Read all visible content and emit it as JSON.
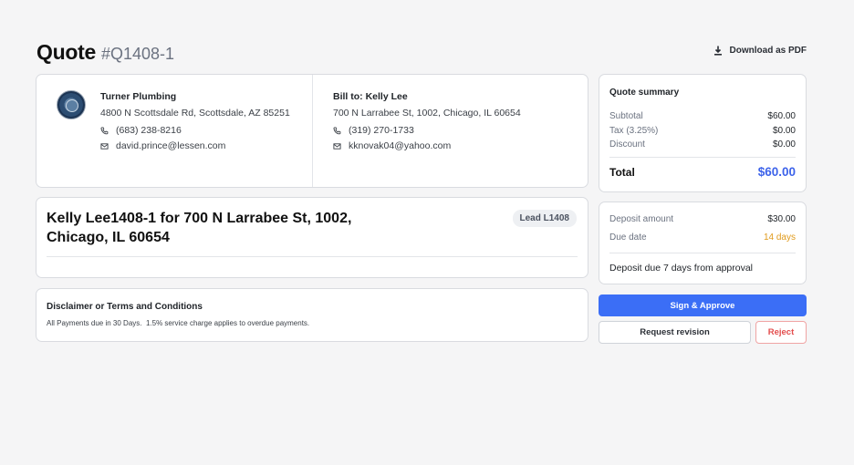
{
  "header": {
    "title": "Quote",
    "quote_number": "#Q1408-1",
    "download_label": "Download as PDF"
  },
  "company": {
    "name": "Turner Plumbing",
    "address": "4800 N Scottsdale Rd, Scottsdale, AZ 85251",
    "phone": "(683) 238-8216",
    "email": "david.prince@lessen.com"
  },
  "bill_to": {
    "label": "Bill to: Kelly Lee",
    "address": "700 N Larrabee St, 1002, Chicago, IL 60654",
    "phone": "(319) 270-1733",
    "email": "kknovak04@yahoo.com"
  },
  "quote": {
    "title": "Kelly Lee1408-1 for 700 N Larrabee St, 1002, Chicago, IL 60654",
    "lead_badge": "Lead L1408"
  },
  "terms": {
    "heading": "Disclaimer or Terms and Conditions",
    "text": "All Payments due in 30 Days.  1.5% service charge applies to overdue payments."
  },
  "summary": {
    "heading": "Quote summary",
    "subtotal_label": "Subtotal",
    "subtotal": "$60.00",
    "tax_label": "Tax (3.25%)",
    "tax": "$0.00",
    "discount_label": "Discount",
    "discount": "$0.00",
    "total_label": "Total",
    "total": "$60.00"
  },
  "deposit": {
    "amount_label": "Deposit amount",
    "amount": "$30.00",
    "due_label": "Due date",
    "due": "14 days",
    "note": "Deposit due 7 days from approval"
  },
  "actions": {
    "approve": "Sign & Approve",
    "revision": "Request revision",
    "reject": "Reject"
  },
  "colors": {
    "accent": "#3b6ef6",
    "total": "#3d63ea",
    "due": "#e09a1b",
    "reject": "#e34d4d"
  }
}
